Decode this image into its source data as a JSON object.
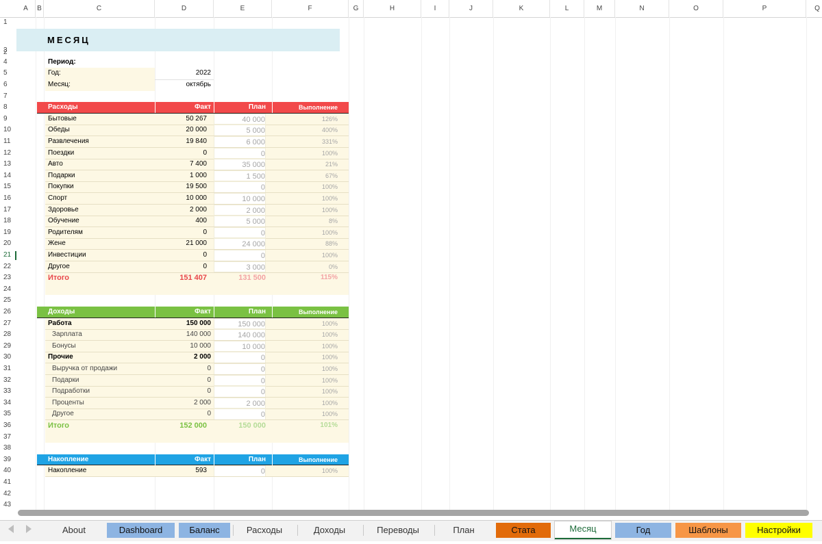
{
  "columns": [
    "A",
    "B",
    "C",
    "D",
    "E",
    "F",
    "G",
    "H",
    "I",
    "J",
    "K",
    "L",
    "M",
    "N",
    "O",
    "P",
    "Q"
  ],
  "rows": [
    "1",
    "2",
    "3",
    "4",
    "5",
    "6",
    "7",
    "8",
    "9",
    "10",
    "11",
    "12",
    "13",
    "14",
    "15",
    "16",
    "17",
    "18",
    "19",
    "20",
    "21",
    "22",
    "23",
    "24",
    "25",
    "26",
    "27",
    "28",
    "29",
    "30",
    "31",
    "32",
    "33",
    "34",
    "35",
    "36",
    "37",
    "38",
    "39",
    "40",
    "41",
    "42",
    "43"
  ],
  "active_row": "21",
  "title": "МЕСЯЦ",
  "period": {
    "label": "Период:",
    "year_label": "Год:",
    "year": "2022",
    "month_label": "Месяц:",
    "month": "октябрь"
  },
  "expenses": {
    "header": [
      "Расходы",
      "Факт",
      "План",
      "Выполнение"
    ],
    "color": "#f2494a",
    "rows": [
      [
        "Бытовые",
        "50 267",
        "40 000",
        "126%"
      ],
      [
        "Обеды",
        "20 000",
        "5 000",
        "400%"
      ],
      [
        "Развлечения",
        "19 840",
        "6 000",
        "331%"
      ],
      [
        "Поездки",
        "0",
        "0",
        "100%"
      ],
      [
        "Авто",
        "7 400",
        "35 000",
        "21%"
      ],
      [
        "Подарки",
        "1 000",
        "1 500",
        "67%"
      ],
      [
        "Покупки",
        "19 500",
        "0",
        "100%"
      ],
      [
        "Спорт",
        "10 000",
        "10 000",
        "100%"
      ],
      [
        "Здоровье",
        "2 000",
        "2 000",
        "100%"
      ],
      [
        "Обучение",
        "400",
        "5 000",
        "8%"
      ],
      [
        "Родителям",
        "0",
        "0",
        "100%"
      ],
      [
        "Жене",
        "21 000",
        "24 000",
        "88%"
      ],
      [
        "Инвестиции",
        "0",
        "0",
        "100%"
      ],
      [
        "Другое",
        "0",
        "3 000",
        "0%"
      ]
    ],
    "total": [
      "Итого",
      "151 407",
      "131 500",
      "115%"
    ]
  },
  "income": {
    "header": [
      "Доходы",
      "Факт",
      "План",
      "Выполнение"
    ],
    "color": "#7ac143",
    "rows": [
      [
        "Работа",
        "150 000",
        "150 000",
        "100%",
        "group"
      ],
      [
        "Зарплата",
        "140 000",
        "140 000",
        "100%",
        "sub"
      ],
      [
        "Бонусы",
        "10 000",
        "10 000",
        "100%",
        "sub"
      ],
      [
        "Прочие",
        "2 000",
        "0",
        "100%",
        "group"
      ],
      [
        "Выручка от продажи",
        "0",
        "0",
        "100%",
        "sub"
      ],
      [
        "Подарки",
        "0",
        "0",
        "100%",
        "sub"
      ],
      [
        "Подработки",
        "0",
        "0",
        "100%",
        "sub"
      ],
      [
        "Проценты",
        "2 000",
        "2 000",
        "100%",
        "sub"
      ],
      [
        "Другое",
        "0",
        "0",
        "100%",
        "sub"
      ]
    ],
    "total": [
      "Итого",
      "152 000",
      "150 000",
      "101%"
    ]
  },
  "savings": {
    "header": [
      "Накопление",
      "Факт",
      "План",
      "Выполнение"
    ],
    "color": "#1fa3e4",
    "rows": [
      [
        "Накопление",
        "593",
        "0",
        "100%"
      ]
    ]
  },
  "sheet_tabs": [
    {
      "label": "About",
      "bg": "#f2f2f2",
      "color": "#333"
    },
    {
      "label": "Dashboard",
      "bg": "#8db4e2",
      "color": "#111"
    },
    {
      "label": "Баланс",
      "bg": "#8db4e2",
      "color": "#111"
    },
    {
      "label": "Расходы",
      "bg": "#f2f2f2",
      "color": "#333"
    },
    {
      "label": "Доходы",
      "bg": "#f2f2f2",
      "color": "#333"
    },
    {
      "label": "Переводы",
      "bg": "#f2f2f2",
      "color": "#333"
    },
    {
      "label": "План",
      "bg": "#f2f2f2",
      "color": "#333"
    },
    {
      "label": "Стата",
      "bg": "#e26b0a",
      "color": "#111"
    },
    {
      "label": "Месяц",
      "bg": "#ffffff",
      "color": "#1d6b39",
      "active": true
    },
    {
      "label": "Год",
      "bg": "#8db4e2",
      "color": "#111"
    },
    {
      "label": "Шаблоны",
      "bg": "#f79646",
      "color": "#111"
    },
    {
      "label": "Настройки",
      "bg": "#ffff00",
      "color": "#111"
    }
  ]
}
